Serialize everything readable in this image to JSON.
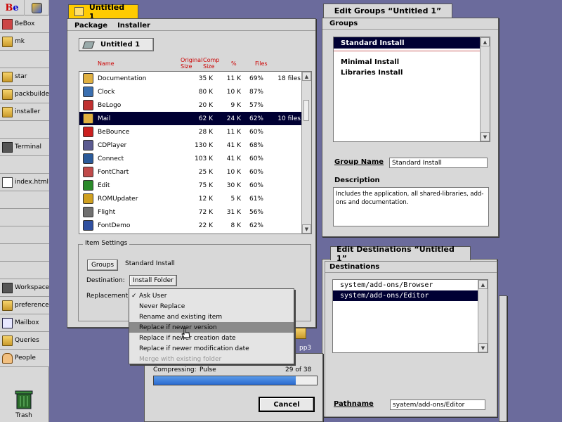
{
  "deskbar": {
    "items": [
      {
        "label": "BeBox",
        "icon": "bebox-icon"
      },
      {
        "label": "mk",
        "icon": "package-icon"
      },
      {
        "label": "",
        "icon": ""
      },
      {
        "label": "star",
        "icon": "folder-icon"
      },
      {
        "label": "packbuilder",
        "icon": "folder-icon"
      },
      {
        "label": "installer",
        "icon": "folder-icon"
      },
      {
        "label": "",
        "icon": ""
      },
      {
        "label": "Terminal",
        "icon": "terminal-icon"
      },
      {
        "label": "",
        "icon": ""
      },
      {
        "label": "index.html",
        "icon": "document-icon"
      },
      {
        "label": "",
        "icon": ""
      },
      {
        "label": "",
        "icon": ""
      },
      {
        "label": "",
        "icon": ""
      },
      {
        "label": "",
        "icon": ""
      },
      {
        "label": "",
        "icon": ""
      },
      {
        "label": "Workspaces",
        "icon": "workspaces-icon"
      },
      {
        "label": "preferences",
        "icon": "folder-icon"
      },
      {
        "label": "Mailbox",
        "icon": "mailbox-icon"
      },
      {
        "label": "Queries",
        "icon": "folder-icon"
      },
      {
        "label": "People",
        "icon": "people-icon"
      }
    ],
    "trash_label": "Trash"
  },
  "main_window": {
    "title": "Untitled 1",
    "menu": [
      "Package",
      "Installer"
    ],
    "package_button": "Untitled 1",
    "columns": {
      "name": "Name",
      "orig": "Original Size",
      "comp": "Comp Size",
      "pct": "%",
      "files": "Files"
    },
    "rows": [
      {
        "name": "Documentation",
        "orig": "35 K",
        "comp": "11 K",
        "pct": "69%",
        "files": "18 files",
        "color": "#e0b040"
      },
      {
        "name": "Clock",
        "orig": "80 K",
        "comp": "10 K",
        "pct": "87%",
        "files": "",
        "color": "#3a6fb0"
      },
      {
        "name": "BeLogo",
        "orig": "20 K",
        "comp": "9 K",
        "pct": "57%",
        "files": "",
        "color": "#c03030"
      },
      {
        "name": "Mail",
        "orig": "62 K",
        "comp": "24 K",
        "pct": "62%",
        "files": "10 files",
        "color": "#e0b040",
        "selected": true
      },
      {
        "name": "BeBounce",
        "orig": "28 K",
        "comp": "11 K",
        "pct": "60%",
        "files": "",
        "color": "#cc2020"
      },
      {
        "name": "CDPlayer",
        "orig": "130 K",
        "comp": "41 K",
        "pct": "68%",
        "files": "",
        "color": "#5a5a90"
      },
      {
        "name": "Connect",
        "orig": "103 K",
        "comp": "41 K",
        "pct": "60%",
        "files": "",
        "color": "#2a5a9a"
      },
      {
        "name": "FontChart",
        "orig": "25 K",
        "comp": "10 K",
        "pct": "60%",
        "files": "",
        "color": "#c04a4a"
      },
      {
        "name": "Edit",
        "orig": "75 K",
        "comp": "30 K",
        "pct": "60%",
        "files": "",
        "color": "#2a8a2a"
      },
      {
        "name": "ROMUpdater",
        "orig": "12 K",
        "comp": "5 K",
        "pct": "61%",
        "files": "",
        "color": "#d0a020"
      },
      {
        "name": "Flight",
        "orig": "72 K",
        "comp": "31 K",
        "pct": "56%",
        "files": "",
        "color": "#707070"
      },
      {
        "name": "FontDemo",
        "orig": "22 K",
        "comp": "8 K",
        "pct": "62%",
        "files": "",
        "color": "#3050a0"
      }
    ],
    "item_settings": {
      "legend": "Item Settings",
      "groups_button": "Groups",
      "groups_value": "Standard Install",
      "destination_label": "Destination:",
      "destination_button": "Install Folder",
      "replacement_label": "Replacement:"
    }
  },
  "replacement_menu": {
    "items": [
      {
        "label": "Ask User",
        "checked": true
      },
      {
        "label": "Never Replace"
      },
      {
        "label": "Rename and existing item"
      },
      {
        "label": "Replace if newer version",
        "highlighted": true
      },
      {
        "label": "Replace if newer creation date"
      },
      {
        "label": "Replace if newer modification date"
      },
      {
        "label": "Merge with existing folder",
        "disabled": true
      }
    ]
  },
  "progress_window": {
    "label": "Compressing:",
    "item": "Pulse",
    "count": "29 of 38",
    "progress": 0.87,
    "cancel": "Cancel"
  },
  "groups_window": {
    "title": "Edit Groups “Untitled 1”",
    "heading": "Groups",
    "items": [
      "Standard Install",
      "Minimal Install",
      "Libraries Install"
    ],
    "group_name_label": "Group Name",
    "group_name_value": "Standard Install",
    "description_label": "Description",
    "description_value": "Includes the application, all shared-libraries, add-ons and documentation."
  },
  "dest_window": {
    "title": "Edit Destinations “Untitled 1”",
    "heading": "Destinations",
    "items": [
      "system/add-ons/Browser",
      "system/add-ons/Editor"
    ],
    "pathname_label": "Pathname",
    "pathname_value": "syatem/add-ons/Editor"
  },
  "desktop_icon_label": "pp3"
}
